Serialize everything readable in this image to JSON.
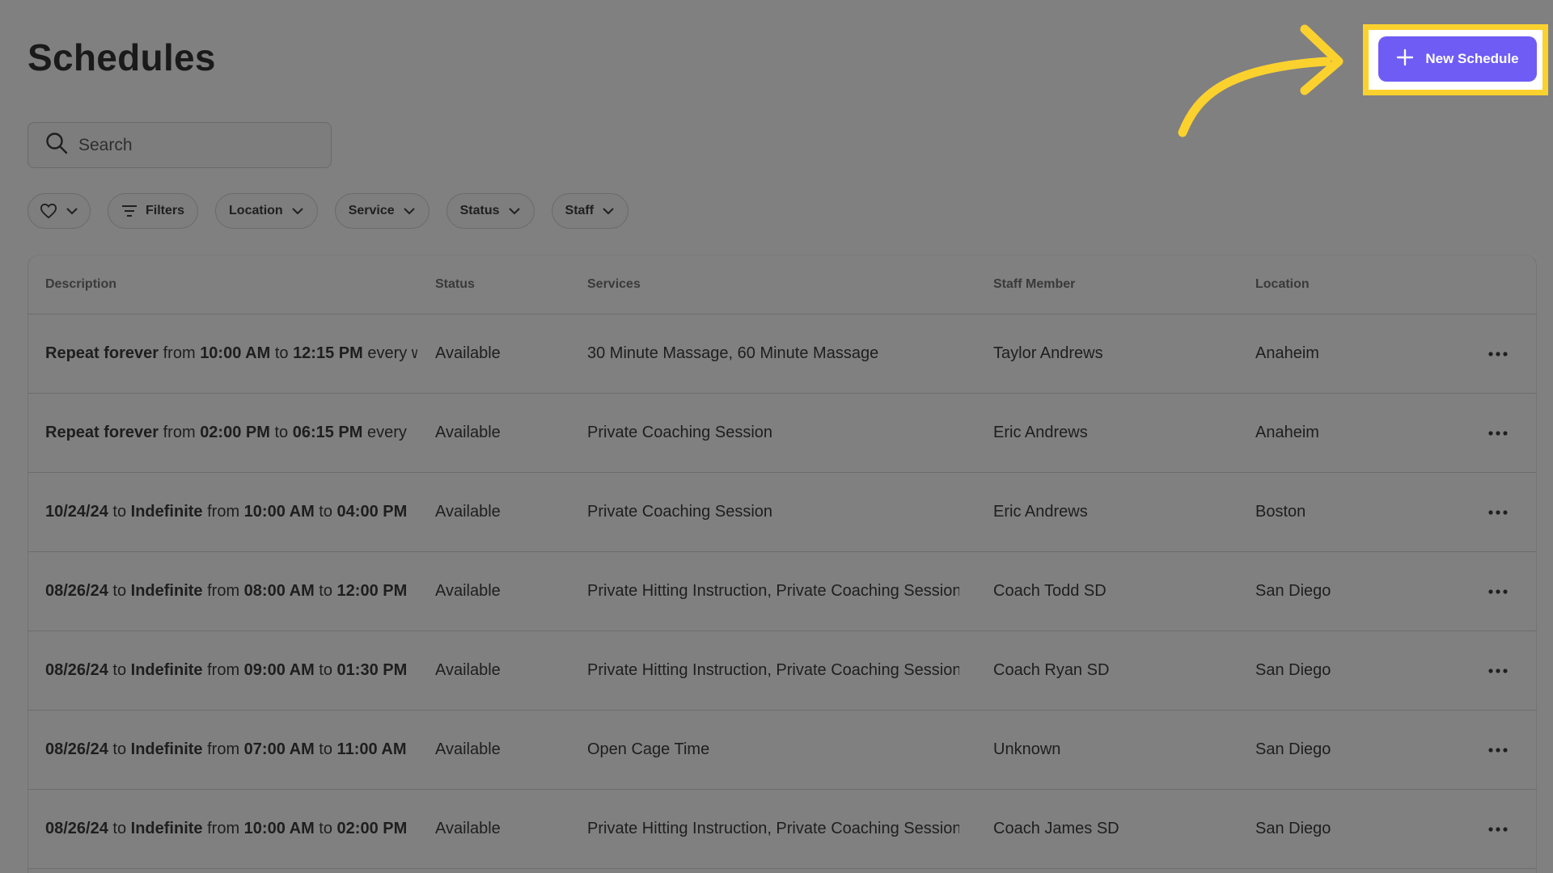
{
  "header": {
    "title": "Schedules",
    "new_button_label": "New Schedule",
    "accent_color": "#6e5cf5",
    "highlight_color": "#fbd12e"
  },
  "search": {
    "placeholder": "Search",
    "icon": "search-icon"
  },
  "filters": [
    {
      "label": "",
      "icon": "heart-icon"
    },
    {
      "label": "Filters",
      "icon": "filter-lines-icon"
    },
    {
      "label": "Location"
    },
    {
      "label": "Service"
    },
    {
      "label": "Status"
    },
    {
      "label": "Staff"
    }
  ],
  "table": {
    "columns": [
      "Description",
      "Status",
      "Services",
      "Staff Member",
      "Location"
    ],
    "rows": [
      {
        "description": [
          [
            "Repeat forever",
            true
          ],
          [
            " from ",
            false
          ],
          [
            "10:00 AM",
            true
          ],
          [
            " to ",
            false
          ],
          [
            "12:15 PM",
            true
          ],
          [
            " every w",
            false
          ]
        ],
        "status": "Available",
        "services": "30 Minute Massage, 60 Minute Massage",
        "staff": "Taylor Andrews",
        "location": "Anaheim"
      },
      {
        "description": [
          [
            "Repeat forever",
            true
          ],
          [
            " from ",
            false
          ],
          [
            "02:00 PM",
            true
          ],
          [
            " to ",
            false
          ],
          [
            "06:15 PM",
            true
          ],
          [
            " every",
            false
          ]
        ],
        "status": "Available",
        "services": "Private Coaching Session",
        "staff": "Eric Andrews",
        "location": "Anaheim"
      },
      {
        "description": [
          [
            "10/24/24",
            true
          ],
          [
            " to ",
            false
          ],
          [
            "Indefinite",
            true
          ],
          [
            " from ",
            false
          ],
          [
            "10:00 AM",
            true
          ],
          [
            " to ",
            false
          ],
          [
            "04:00 PM",
            true
          ]
        ],
        "status": "Available",
        "services": "Private Coaching Session",
        "staff": "Eric Andrews",
        "location": "Boston"
      },
      {
        "description": [
          [
            "08/26/24",
            true
          ],
          [
            " to ",
            false
          ],
          [
            "Indefinite",
            true
          ],
          [
            " from ",
            false
          ],
          [
            "08:00 AM",
            true
          ],
          [
            " to ",
            false
          ],
          [
            "12:00 PM",
            true
          ]
        ],
        "status": "Available",
        "services": "Private Hitting Instruction, Private Coaching Session",
        "staff": "Coach Todd SD",
        "location": "San Diego"
      },
      {
        "description": [
          [
            "08/26/24",
            true
          ],
          [
            " to ",
            false
          ],
          [
            "Indefinite",
            true
          ],
          [
            " from ",
            false
          ],
          [
            "09:00 AM",
            true
          ],
          [
            " to ",
            false
          ],
          [
            "01:30 PM",
            true
          ]
        ],
        "status": "Available",
        "services": "Private Hitting Instruction, Private Coaching Session",
        "staff": "Coach Ryan SD",
        "location": "San Diego"
      },
      {
        "description": [
          [
            "08/26/24",
            true
          ],
          [
            " to ",
            false
          ],
          [
            "Indefinite",
            true
          ],
          [
            " from ",
            false
          ],
          [
            "07:00 AM",
            true
          ],
          [
            " to ",
            false
          ],
          [
            "11:00 AM",
            true
          ]
        ],
        "status": "Available",
        "services": "Open Cage Time",
        "staff": "Unknown",
        "location": "San Diego"
      },
      {
        "description": [
          [
            "08/26/24",
            true
          ],
          [
            " to ",
            false
          ],
          [
            "Indefinite",
            true
          ],
          [
            " from ",
            false
          ],
          [
            "10:00 AM",
            true
          ],
          [
            " to ",
            false
          ],
          [
            "02:00 PM",
            true
          ]
        ],
        "status": "Available",
        "services": "Private Hitting Instruction, Private Coaching Session",
        "staff": "Coach James SD",
        "location": "San Diego"
      }
    ]
  }
}
